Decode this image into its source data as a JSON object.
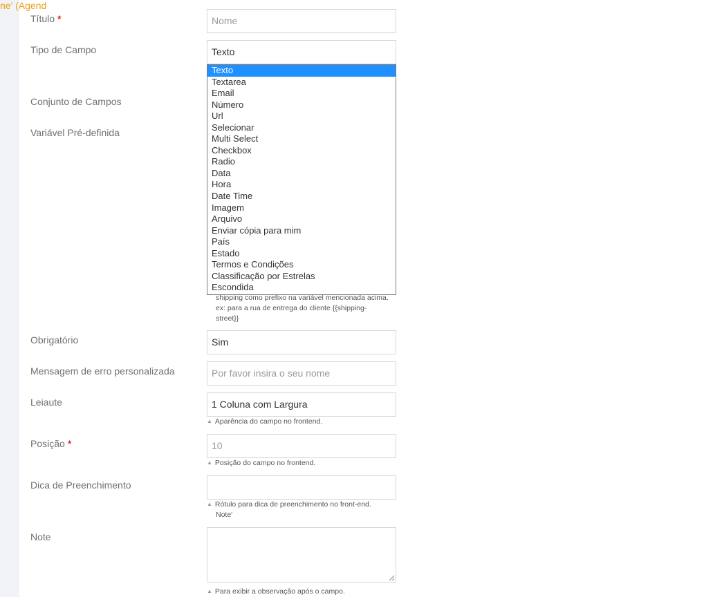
{
  "header": {
    "breadcrumb_fragment": "ne' (Agend"
  },
  "form": {
    "title": {
      "label": "Título",
      "required_mark": "*",
      "placeholder": "Nome"
    },
    "field_type": {
      "label": "Tipo de Campo",
      "value": "Texto",
      "options": [
        "Texto",
        "Textarea",
        "Email",
        "Número",
        "Url",
        "Selecionar",
        "Multi Select",
        "Checkbox",
        "Radio",
        "Data",
        "Hora",
        "Date Time",
        "Imagem",
        "Arquivo",
        "Enviar cópia para mim",
        "País",
        "Estado",
        "Termos e Condições",
        "Classificação por Estrelas",
        "Escondida"
      ],
      "selected_index": 0
    },
    "fieldset": {
      "label": "Conjunto de Campos"
    },
    "predefined_variable": {
      "label": "Variável Pré-definida",
      "help_visible": "shipping como prefixo na variável mencionada acima. ex: para a rua de entrega do cliente {{shipping-street}}"
    },
    "required": {
      "label": "Obrigatório",
      "value": "Sim"
    },
    "custom_error": {
      "label": "Mensagem de erro personalizada",
      "placeholder": "Por favor insira o seu nome"
    },
    "layout": {
      "label": "Leiaute",
      "value": "1 Coluna com Largura",
      "hint": "Aparência do campo no frontend."
    },
    "position": {
      "label": "Posição",
      "required_mark": "*",
      "value": "10",
      "hint": "Posição do campo no frontend."
    },
    "placeholder_hint": {
      "label": "Dica de Preenchimento",
      "value": "",
      "hint_line1": "Rótulo para dica de preenchimento no front-end.",
      "hint_line2": "Note'"
    },
    "note": {
      "label": "Note",
      "value": "",
      "hint": "Para exibir a observação após o campo."
    }
  },
  "colors": {
    "accent": "#1e90ff",
    "required": "#e02b27",
    "crumb": "#e8a21b"
  },
  "icons": {
    "hint_marker": "triangle-up-icon",
    "resize": "resize-grip-icon"
  }
}
